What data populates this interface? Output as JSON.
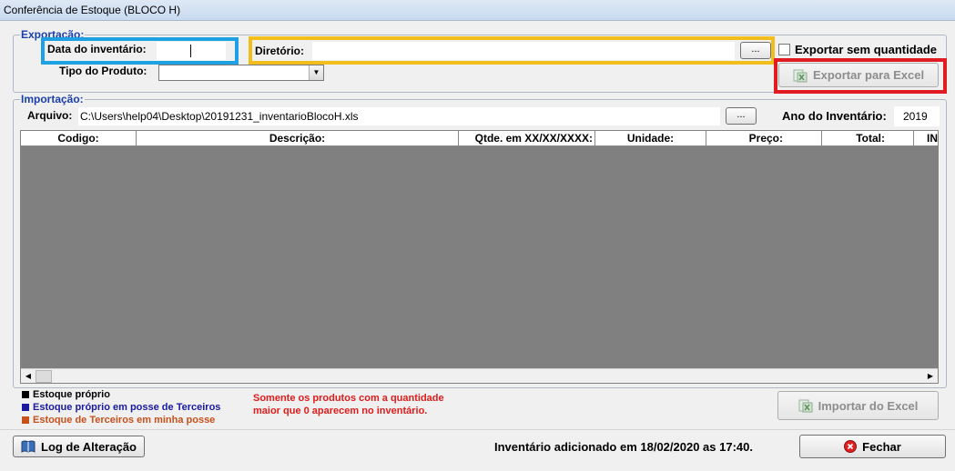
{
  "window": {
    "title": "Conferência de Estoque (BLOCO H)"
  },
  "exportacao": {
    "group_title": "Exportação:",
    "data_label": "Data do inventário:",
    "data_value": "",
    "diretorio_label": "Diretório:",
    "diretorio_value": "",
    "browse_label": "...",
    "sem_quantidade_label": "Exportar sem quantidade",
    "tipo_label": "Tipo do Produto:",
    "tipo_value": "",
    "export_button": "Exportar para Excel"
  },
  "importacao": {
    "group_title": "Importação:",
    "arquivo_label": "Arquivo:",
    "arquivo_value": "C:\\Users\\help04\\Desktop\\20191231_inventarioBlocoH.xls",
    "browse_label": "...",
    "ano_label": "Ano do Inventário:",
    "ano_value": "2019",
    "columns": [
      "Codigo:",
      "Descrição:",
      "Qtde. em XX/XX/XXXX:",
      "Unidade:",
      "Preço:",
      "Total:",
      "IN"
    ]
  },
  "legend": {
    "items": [
      {
        "label": "Estoque próprio",
        "color": "#000000"
      },
      {
        "label": "Estoque próprio em posse de Terceiros",
        "color": "#1a1aa0"
      },
      {
        "label": "Estoque de Terceiros em minha posse",
        "color": "#c8501a"
      }
    ]
  },
  "notice": {
    "line1": "Somente os produtos com a quantidade",
    "line2": "maior que 0 aparecem no inventário.",
    "color": "#e01b1b"
  },
  "import_button": "Importar do Excel",
  "log_button": "Log de Alteração",
  "status_text": "Inventário adicionado em 18/02/2020 as 17:40.",
  "close_button": "Fechar",
  "colors": {
    "highlight_blue": "#1da1e2",
    "highlight_yellow": "#f1be1b",
    "highlight_red": "#e01b22",
    "grid_body": "#808080"
  }
}
